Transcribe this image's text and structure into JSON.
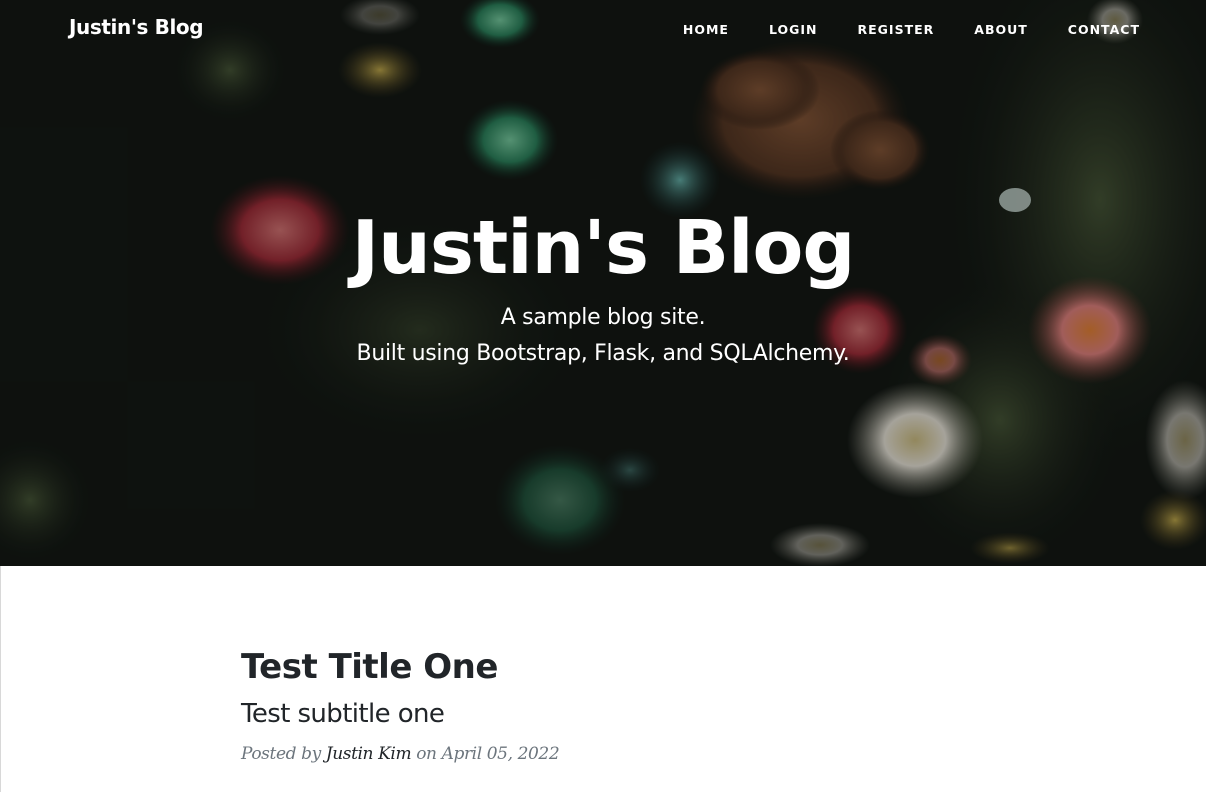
{
  "navbar": {
    "brand": "Justin's Blog",
    "links": [
      "HOME",
      "LOGIN",
      "REGISTER",
      "ABOUT",
      "CONTACT"
    ]
  },
  "hero": {
    "title": "Justin's Blog",
    "subtitle_line1": "A sample blog site.",
    "subtitle_line2": "Built using Bootstrap, Flask, and SQLAlchemy."
  },
  "posts": [
    {
      "title": "Test Title One",
      "subtitle": "Test subtitle one",
      "meta_prefix": "Posted by",
      "author": "Justin Kim",
      "meta_on": "on",
      "date": "April 05, 2022"
    }
  ],
  "colors": {
    "text_dark": "#212529",
    "text_muted": "#6c757d",
    "hero_text": "#ffffff"
  }
}
